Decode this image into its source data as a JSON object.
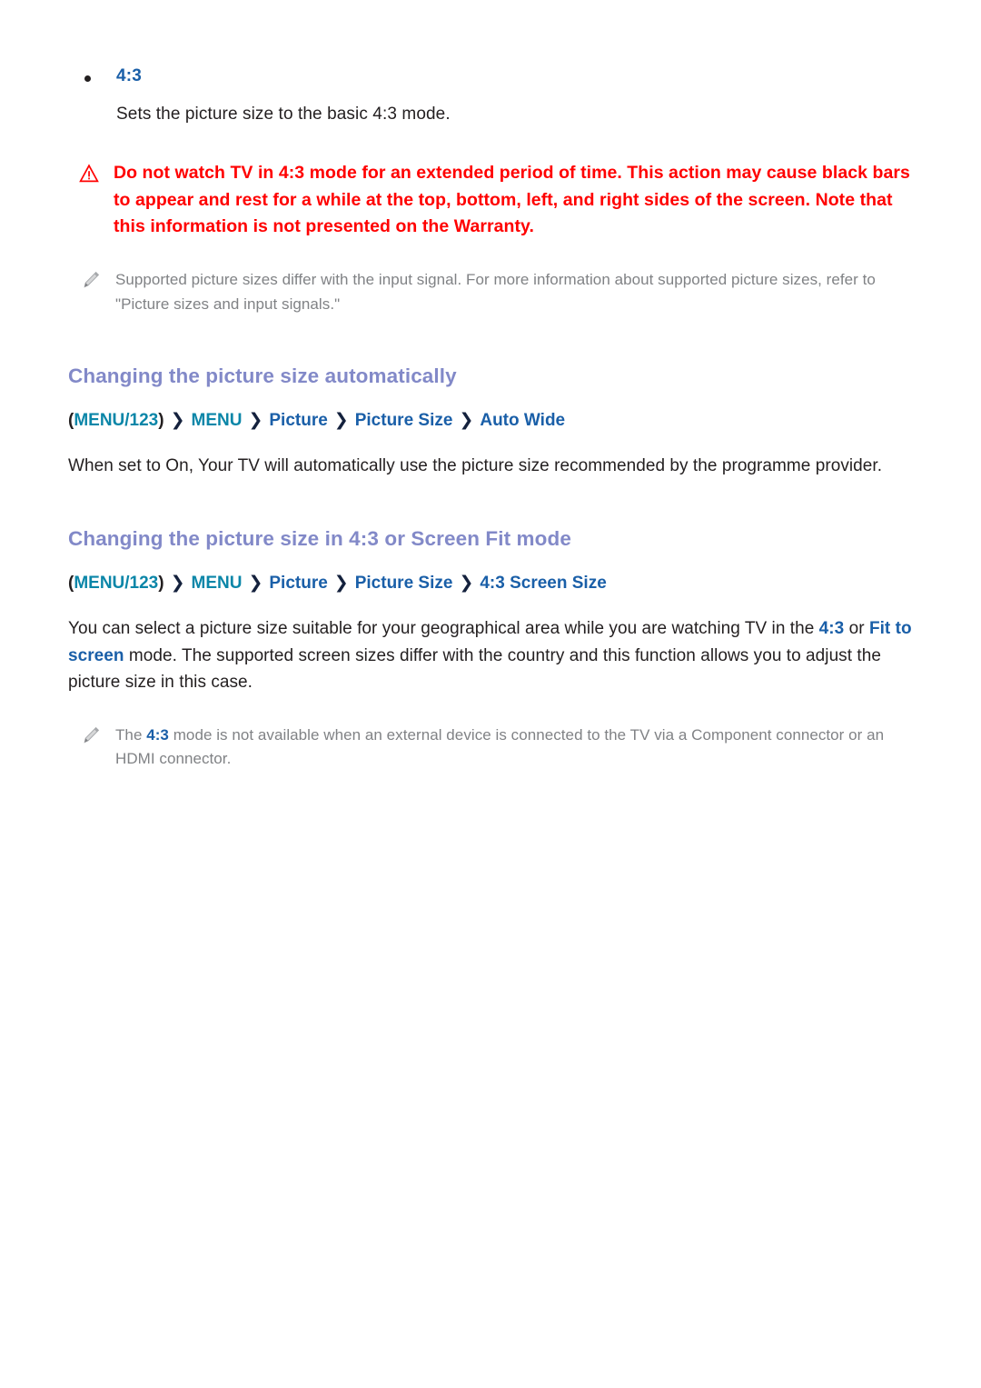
{
  "bullet_item": {
    "icon": "bullet-dot",
    "title": "4:3",
    "description": "Sets the picture size to the basic 4:3 mode."
  },
  "warning": {
    "icon": "warning-triangle-icon",
    "text": "Do not watch TV in 4:3 mode for an extended period of time. This action may cause black bars to appear and rest for a while at the top, bottom, left, and right sides of the screen. Note that this information is not presented on the Warranty."
  },
  "note_1": {
    "icon": "pencil-note-icon",
    "text": "Supported picture sizes differ with the input signal. For more information about supported picture sizes, refer to \"Picture sizes and input signals.\""
  },
  "sections": [
    {
      "heading": "Changing the picture size automatically",
      "breadcrumb": {
        "open_paren": "(",
        "close_paren": ")",
        "items": [
          {
            "label": "MENU/123",
            "color": "teal"
          },
          {
            "label": "MENU",
            "color": "teal"
          },
          {
            "label": "Picture",
            "color": "blue"
          },
          {
            "label": "Picture Size",
            "color": "blue"
          },
          {
            "label": "Auto Wide",
            "color": "blue"
          }
        ],
        "separator": "❯"
      },
      "body": {
        "part_1": "When set to On, Your TV will automatically use the picture size recommended by the programme provider."
      }
    },
    {
      "heading": "Changing the picture size in 4:3 or Screen Fit mode",
      "breadcrumb": {
        "open_paren": "(",
        "close_paren": ")",
        "items": [
          {
            "label": "MENU/123",
            "color": "teal"
          },
          {
            "label": "MENU",
            "color": "teal"
          },
          {
            "label": "Picture",
            "color": "blue"
          },
          {
            "label": "Picture Size",
            "color": "blue"
          },
          {
            "label": "4:3 Screen Size",
            "color": "blue"
          }
        ],
        "separator": "❯"
      },
      "body": {
        "part_1": "You can select a picture size suitable for your geographical area while you are watching TV in the ",
        "highlight_1": "4:3",
        "part_2": " or ",
        "highlight_2": "Fit to screen",
        "part_3": " mode. The supported screen sizes differ with the country and this function allows you to adjust the picture size in this case."
      }
    }
  ],
  "note_2": {
    "icon": "pencil-note-icon",
    "part_1": "The ",
    "highlight_1": "4:3",
    "part_2": " mode is not available when an external device is connected to the TV via a Component connector or an HDMI connector."
  },
  "colors": {
    "heading": "#8289c8",
    "link_blue": "#1a5fa8",
    "link_teal": "#0b86a8",
    "warning_red": "#ff0000",
    "note_grey": "#808285",
    "body_text": "#231f20",
    "background": "#ffffff"
  }
}
